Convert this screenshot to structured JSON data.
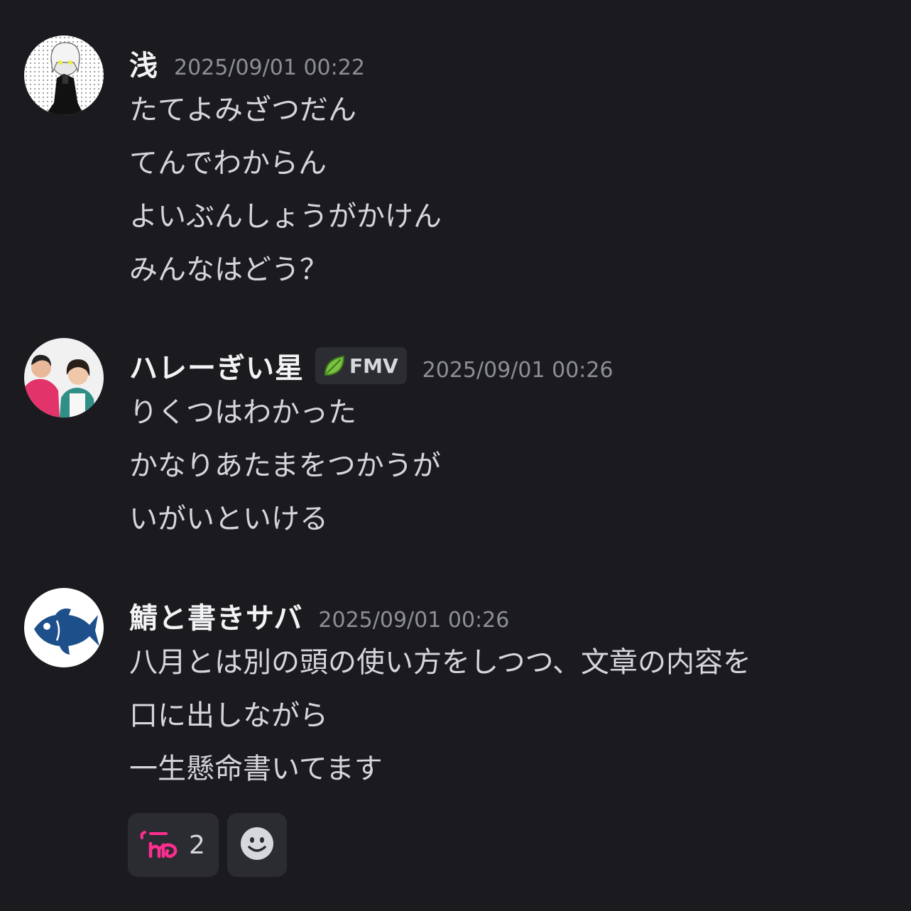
{
  "messages": [
    {
      "username": "浅",
      "timestamp": "2025/09/01 00:22",
      "lines": [
        "たてよみざつだん",
        "てんでわからん",
        "よいぶんしょうがかけん",
        "みんなはどう？"
      ]
    },
    {
      "username": "ハレーぎい星",
      "tag": "FMV",
      "timestamp": "2025/09/01 00:26",
      "lines": [
        "りくつはわかった",
        "かなりあたまをつかうが",
        "いがいといける"
      ]
    },
    {
      "username": "鯖と書きサバ",
      "timestamp": "2025/09/01 00:26",
      "lines": [
        "八月とは別の頭の使い方をしつつ、文章の内容を",
        "口に出しながら",
        "一生懸命書いてます"
      ]
    }
  ],
  "reactions": [
    {
      "emoji": "custom-text-emoji",
      "count": "2"
    },
    {
      "emoji": "add-reaction-icon"
    }
  ],
  "colors": {
    "background": "#1b1b1f",
    "username": "#f2f3f5",
    "text": "#d5d6da",
    "timestamp": "#8d8f97",
    "pill": "#2b2c31",
    "leaf": "#7cc242",
    "fish": "#1d4f8a"
  }
}
